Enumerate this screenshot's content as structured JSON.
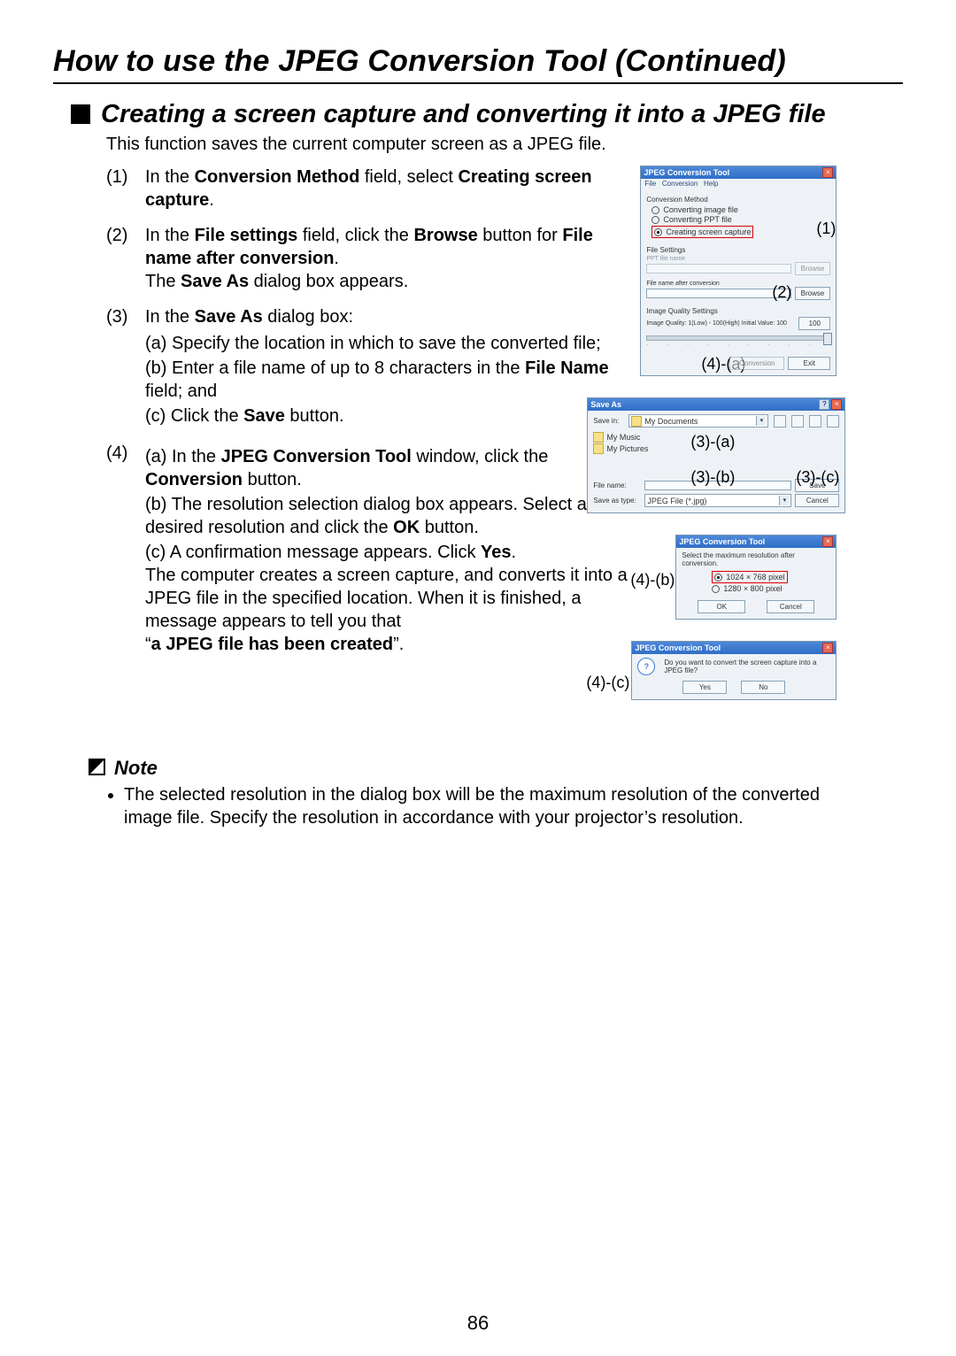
{
  "page": {
    "title": "How to use the JPEG Conversion Tool (Continued)",
    "section_title": "Creating a screen capture and converting it into a JPEG file",
    "intro": "This function saves the current computer screen as a JPEG file.",
    "page_number": "86"
  },
  "steps": {
    "s1": {
      "num": "(1)",
      "text_a": "In the ",
      "b1": "Conversion Method",
      "text_b": " field, select ",
      "b2": "Creating screen capture",
      "text_c": "."
    },
    "s2": {
      "num": "(2)",
      "text_a": "In the ",
      "b1": "File settings",
      "text_b": " field, click the ",
      "b2": "Browse",
      "text_c": " button for ",
      "b3": "File name after conversion",
      "text_d": ".",
      "line2_a": "The ",
      "line2_b": "Save As",
      "line2_c": " dialog box appears."
    },
    "s3": {
      "num": "(3)",
      "text_a": "In the ",
      "b1": "Save As",
      "text_b": " dialog box:",
      "a": "(a) Specify the location in which to save the converted file;",
      "b_a": "(b) Enter a file name of up to 8 characters in the ",
      "b_b": "File Name",
      "b_c": " field; and",
      "c_a": "(c) Click the ",
      "c_b": "Save",
      "c_c": " button."
    },
    "s4": {
      "num": "(4)",
      "a_a": "(a) In the ",
      "a_b": "JPEG Conversion Tool",
      "a_c": " window, click the ",
      "a_d": "Conversion",
      "a_e": " button.",
      "b_a": "(b) The resolution selection dialog box appears. Select a desired resolution and click the ",
      "b_b": "OK",
      "b_c": " button.",
      "c_a": "(c) A confirmation message appears. Click ",
      "c_b": "Yes",
      "c_c": ".",
      "c_line2": "The computer creates a screen capture, and converts it into a JPEG file in the specified location. When it is finished, a message appears to tell you that",
      "c_quote_a": "“",
      "c_quote_b": "a JPEG file has been created",
      "c_quote_c": "”."
    }
  },
  "note": {
    "heading": "Note",
    "item1": "The selected resolution in the dialog box will be the maximum resolution of the converted image file. Specify the resolution in accordance with your projector’s resolution."
  },
  "dlg_tool": {
    "title": "JPEG Conversion Tool",
    "menu_file": "File",
    "menu_conv": "Conversion",
    "menu_help": "Help",
    "grp_method": "Conversion Method",
    "opt1": "Converting image file",
    "opt2": "Converting PPT file",
    "opt3": "Creating screen capture",
    "grp_file": "File Settings",
    "lbl_ppt": "PPT file name",
    "btn_browse1": "Browse",
    "lbl_after": "File name after conversion",
    "btn_browse2": "Browse",
    "grp_quality": "Image Quality Settings",
    "quality_label": "Image Quality: 1(Low) - 100(High) Initial Value: 100",
    "quality_val": "100",
    "btn_conv": "Conversion",
    "btn_exit": "Exit",
    "callout1": "(1)",
    "callout2": "(2)",
    "callout4a": "(4)-(a)"
  },
  "dlg_saveas": {
    "title": "Save As",
    "savein_lbl": "Save in:",
    "savein_val": "My Documents",
    "side_music": "My Music",
    "side_pictures": "My Pictures",
    "filename_lbl": "File name:",
    "filename_val": "",
    "saveastype_lbl": "Save as type:",
    "saveastype_val": "JPEG File (*.jpg)",
    "btn_save": "Save",
    "btn_cancel": "Cancel",
    "callout3a": "(3)-(a)",
    "callout3b": "(3)-(b)",
    "callout3c": "(3)-(c)"
  },
  "dlg_res": {
    "title": "JPEG Conversion Tool",
    "msg": "Select the maximum resolution after conversion.",
    "opt1": "1024 × 768 pixel",
    "opt2": "1280 × 800 pixel",
    "btn_ok": "OK",
    "btn_cancel": "Cancel",
    "callout4b": "(4)-(b)"
  },
  "dlg_confirm": {
    "title": "JPEG Conversion Tool",
    "msg": "Do you want to convert the screen capture into a JPEG file?",
    "btn_yes": "Yes",
    "btn_no": "No",
    "callout4c": "(4)-(c)"
  }
}
